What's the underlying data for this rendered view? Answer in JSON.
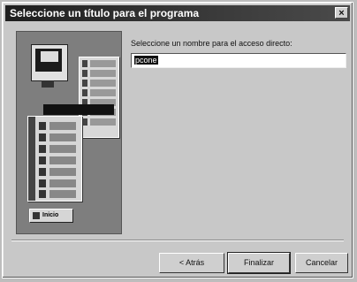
{
  "window": {
    "title": "Seleccione un título para el programa",
    "close": "×"
  },
  "main": {
    "prompt": "Seleccione un nombre para el acceso directo:",
    "shortcut_name": "pcone"
  },
  "buttons": {
    "back": "< Atrás",
    "finish": "Finalizar",
    "cancel": "Cancelar"
  },
  "illustration": {
    "start_label": "Inicio"
  }
}
